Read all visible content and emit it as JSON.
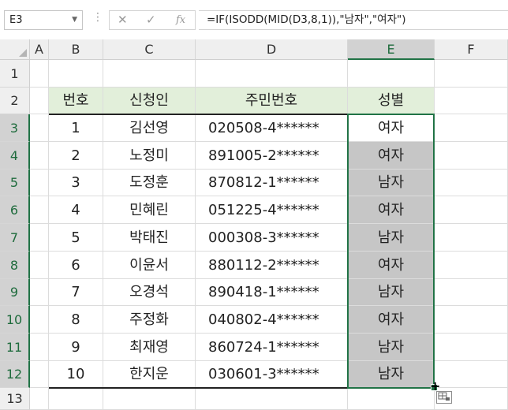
{
  "formula_bar": {
    "name_box": "E3",
    "name_dropdown": "▼",
    "separator": "⋮",
    "cancel_glyph": "✕",
    "enter_glyph": "✓",
    "function_glyph": "fx",
    "formula": "=IF(ISODD(MID(D3,8,1)),\"남자\",\"여자\")"
  },
  "columns": [
    "A",
    "B",
    "C",
    "D",
    "E",
    "F"
  ],
  "selected_column": "E",
  "rows": [
    "1",
    "2",
    "3",
    "4",
    "5",
    "6",
    "7",
    "8",
    "9",
    "10",
    "11",
    "12",
    "13"
  ],
  "selected_rows": [
    "3",
    "4",
    "5",
    "6",
    "7",
    "8",
    "9",
    "10",
    "11",
    "12"
  ],
  "table": {
    "headers": [
      "번호",
      "신청인",
      "주민번호",
      "성별"
    ],
    "records": [
      [
        "1",
        "김선영",
        "020508-4******",
        "여자"
      ],
      [
        "2",
        "노정미",
        "891005-2******",
        "여자"
      ],
      [
        "3",
        "도정훈",
        "870812-1******",
        "남자"
      ],
      [
        "4",
        "민혜린",
        "051225-4******",
        "여자"
      ],
      [
        "5",
        "박태진",
        "000308-3******",
        "남자"
      ],
      [
        "6",
        "이윤서",
        "880112-2******",
        "여자"
      ],
      [
        "7",
        "오경석",
        "890418-1******",
        "남자"
      ],
      [
        "8",
        "주정화",
        "040802-4******",
        "여자"
      ],
      [
        "9",
        "최재영",
        "860724-1******",
        "남자"
      ],
      [
        "10",
        "한지운",
        "030601-3******",
        "남자"
      ]
    ]
  },
  "colors": {
    "header_fill": "#e2efda",
    "selection_fill": "#c6c6c6",
    "accent": "#217346"
  },
  "quick_analysis_icon": "quick-analysis-icon"
}
